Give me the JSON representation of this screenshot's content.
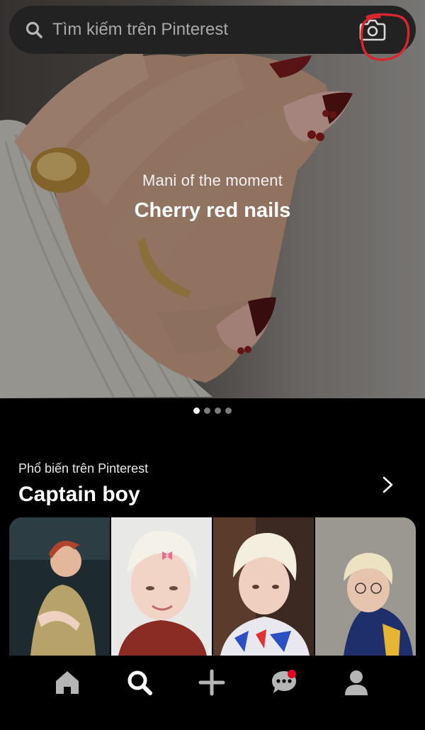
{
  "search": {
    "placeholder": "Tìm kiếm trên Pinterest",
    "left_icon": "search-icon",
    "right_icon": "camera-icon"
  },
  "hero": {
    "subtitle": "Mani of the moment",
    "title": "Cherry red nails",
    "image": "hand-with-cherry-red-nails-and-gold-rings"
  },
  "carousel": {
    "current": 1,
    "total": 4
  },
  "section": {
    "label": "Phổ biến trên Pinterest",
    "title": "Captain boy",
    "more_icon": "chevron-right-icon",
    "thumbnails": [
      {
        "image": "performer-red-hair-stage"
      },
      {
        "image": "blond-boy-pink-bow-clip"
      },
      {
        "image": "blond-boy-patterned-shirt"
      },
      {
        "image": "blond-boy-glasses-jersey"
      }
    ]
  },
  "nav": {
    "items": [
      {
        "icon": "home-icon",
        "active": false
      },
      {
        "icon": "search-icon",
        "active": true
      },
      {
        "icon": "plus-icon",
        "active": false
      },
      {
        "icon": "chat-icon",
        "active": false,
        "badge": true
      },
      {
        "icon": "profile-icon",
        "active": false
      }
    ]
  },
  "colors": {
    "background": "#000000",
    "search_bar": "#222222",
    "notification_badge": "#e60023",
    "annotation": "#d9262e"
  }
}
